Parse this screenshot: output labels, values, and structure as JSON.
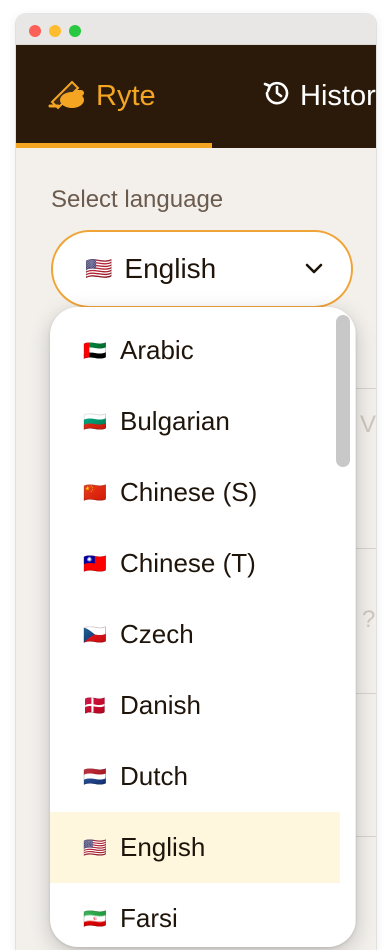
{
  "window": {
    "controls": [
      "close",
      "minimize",
      "maximize"
    ]
  },
  "tabs": [
    {
      "label": "Ryte",
      "icon": "writing-hand-icon",
      "active": true
    },
    {
      "label": "History",
      "icon": "history-icon",
      "active": false
    }
  ],
  "language_select": {
    "label": "Select language",
    "selected_flag": "🇺🇸",
    "selected_value": "English"
  },
  "dropdown": {
    "options": [
      {
        "flag": "🇦🇪",
        "label": "Arabic"
      },
      {
        "flag": "🇧🇬",
        "label": "Bulgarian"
      },
      {
        "flag": "🇨🇳",
        "label": "Chinese (S)"
      },
      {
        "flag": "🇹🇼",
        "label": "Chinese (T)"
      },
      {
        "flag": "🇨🇿",
        "label": "Czech"
      },
      {
        "flag": "🇩🇰",
        "label": "Danish"
      },
      {
        "flag": "🇳🇱",
        "label": "Dutch"
      },
      {
        "flag": "🇺🇸",
        "label": "English",
        "selected": true
      },
      {
        "flag": "🇮🇷",
        "label": "Farsi"
      }
    ]
  },
  "colors": {
    "accent": "#f4a623",
    "header_bg": "#2b1a0a",
    "selected_bg": "#fff6de"
  }
}
